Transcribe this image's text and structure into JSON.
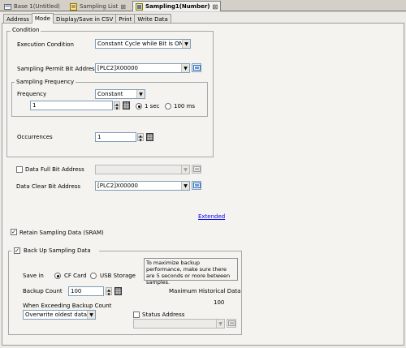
{
  "doc_tabs": [
    {
      "label": "Base 1(Untitled)"
    },
    {
      "label": "Sampling List"
    },
    {
      "label": "Sampling1(Number)"
    }
  ],
  "sub_tabs": [
    "Address",
    "Mode",
    "Display/Save in CSV",
    "Print",
    "Write Data"
  ],
  "condition": {
    "title": "Condition",
    "execution_label": "Execution Condition",
    "execution_value": "Constant Cycle while Bit is ON",
    "permit_label": "Sampling Permit Bit Address",
    "permit_value": "[PLC2]X00000",
    "freq_group_title": "Sampling Frequency",
    "frequency_label": "Frequency",
    "frequency_value": "Constant",
    "interval_value": "1",
    "unit_sec": "1 sec",
    "unit_ms": "100 ms",
    "occurrences_label": "Occurrences",
    "occurrences_value": "1"
  },
  "data_full": {
    "label": "Data Full Bit Address",
    "value": ""
  },
  "data_clear": {
    "label": "Data Clear Bit Address",
    "value": "[PLC2]X00000"
  },
  "extended_link": "Extended",
  "retain": {
    "label": "Retain Sampling Data (SRAM)",
    "checked": true
  },
  "backup": {
    "title": "Back Up Sampling Data",
    "checked": true,
    "save_in_label": "Save in",
    "cf_card": "CF Card",
    "usb_storage": "USB Storage",
    "info_text": "To maximize backup performance, make sure there are 5 seconds or more between samples.",
    "backup_count_label": "Backup Count",
    "backup_count_value": "100",
    "max_hist_label": "Maximum Historical Data",
    "max_hist_value": "100",
    "exceed_label": "When Exceeding Backup Count",
    "exceed_value": "Overwrite oldest data",
    "status_label": "Status Address",
    "status_value": ""
  }
}
